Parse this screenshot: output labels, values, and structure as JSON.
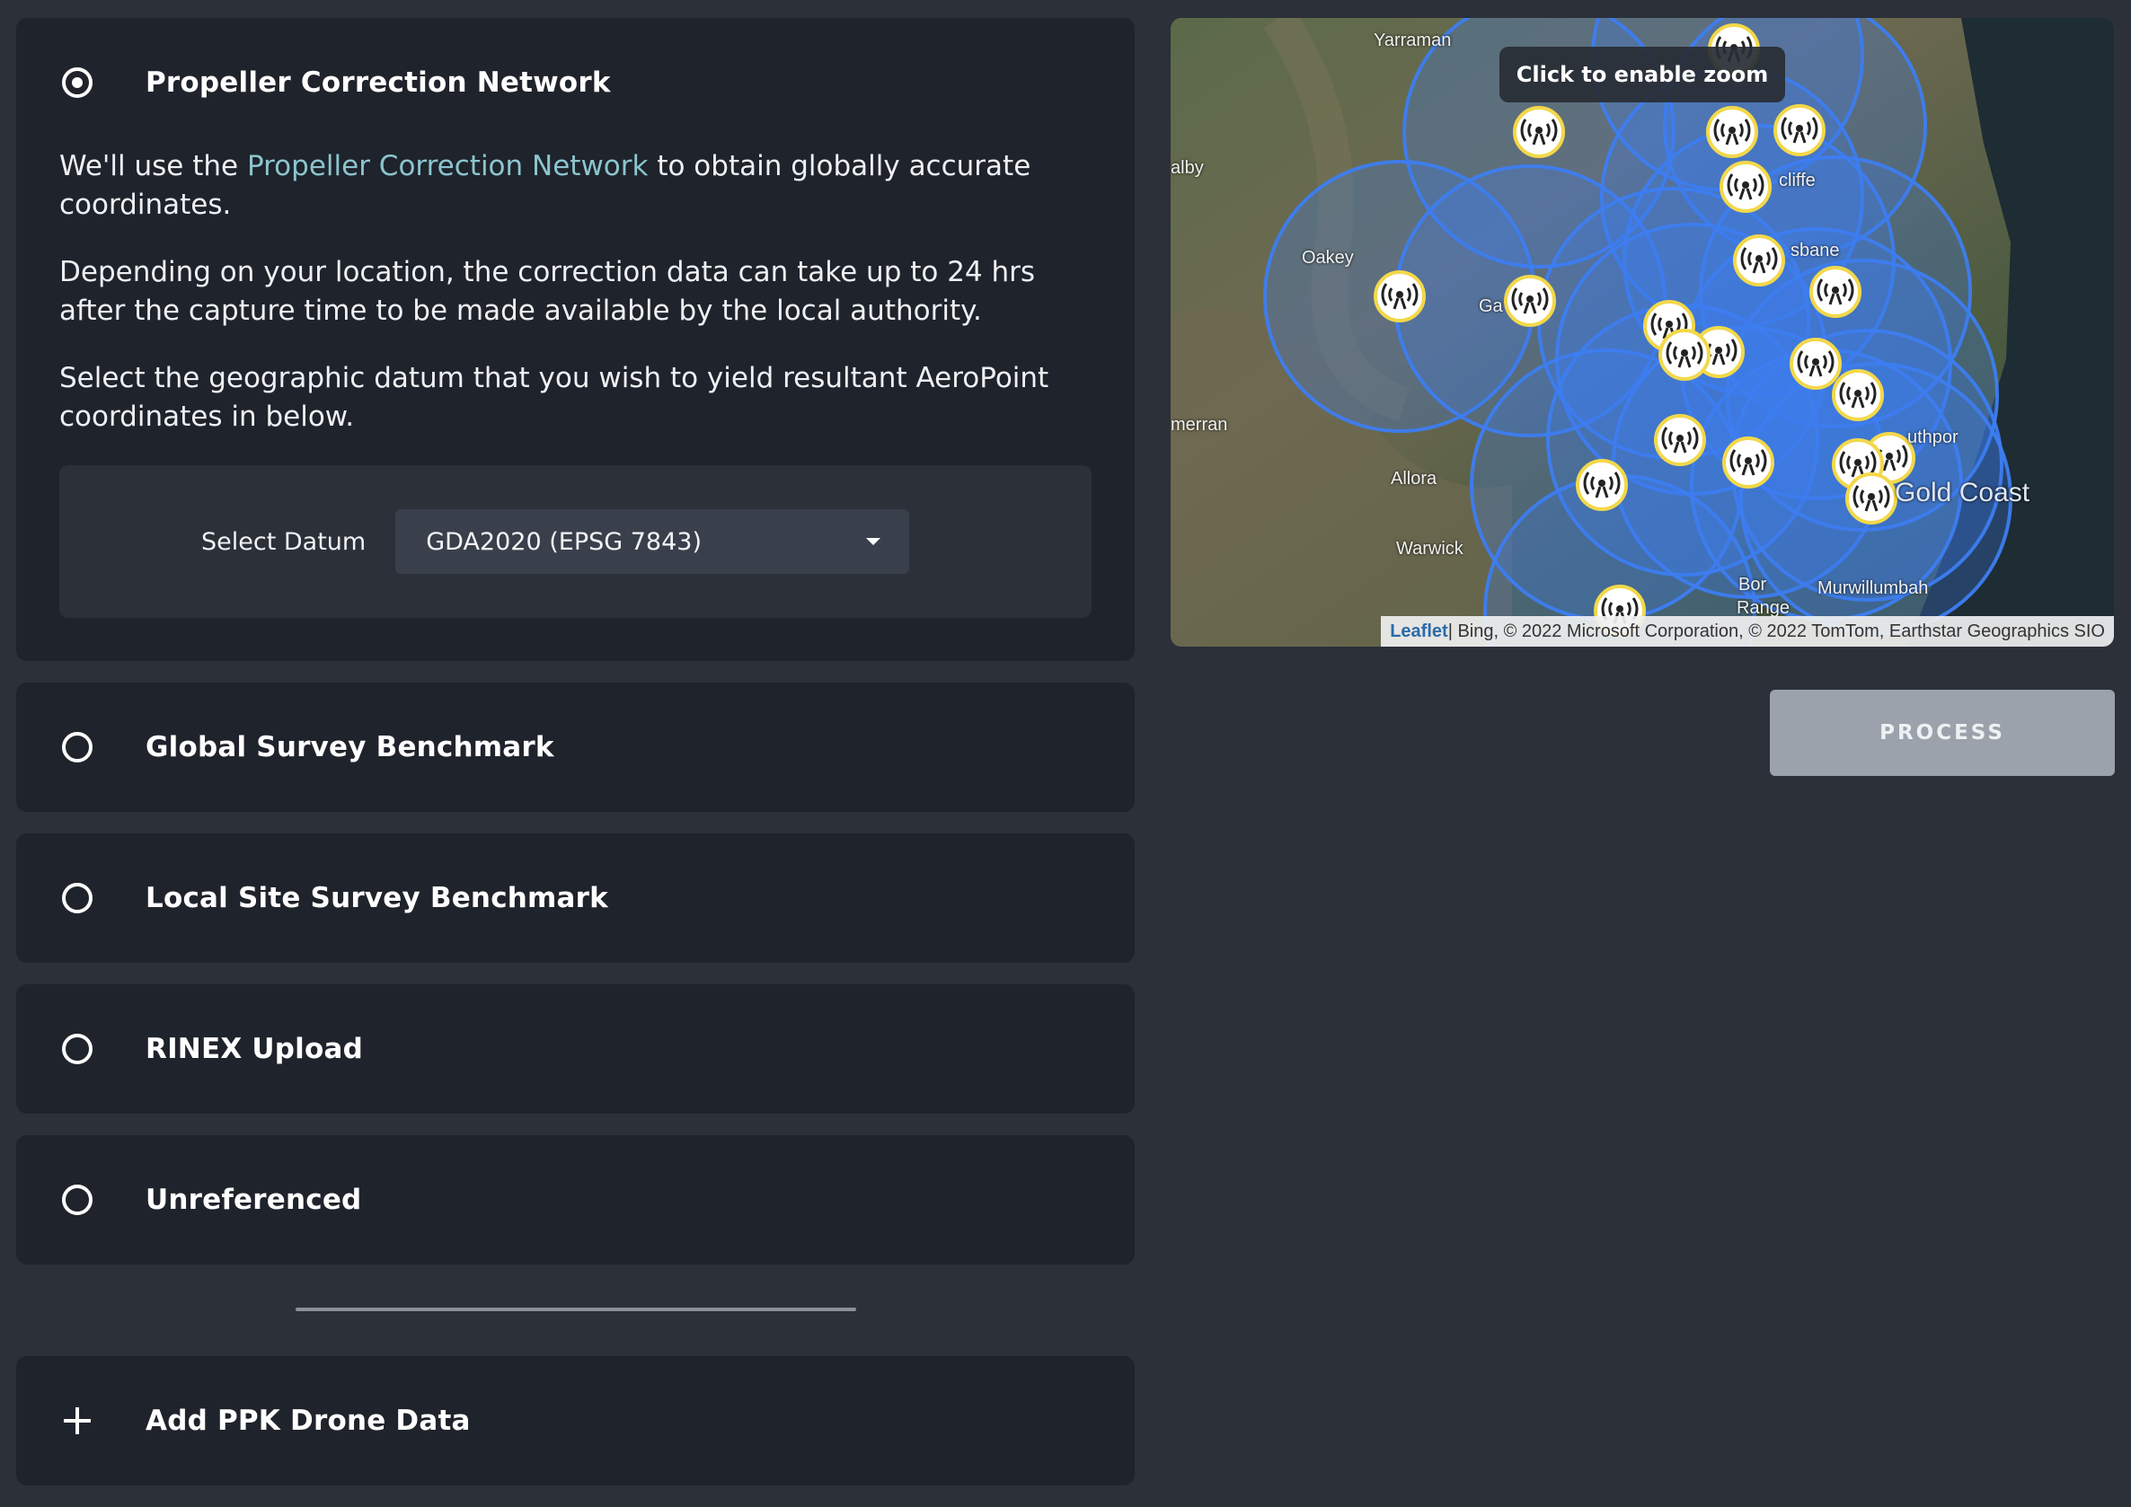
{
  "options": [
    {
      "label": "Propeller Correction Network",
      "selected": true
    },
    {
      "label": "Global Survey Benchmark",
      "selected": false
    },
    {
      "label": "Local Site Survey Benchmark",
      "selected": false
    },
    {
      "label": "RINEX Upload",
      "selected": false
    },
    {
      "label": "Unreferenced",
      "selected": false
    }
  ],
  "pcn": {
    "intro_pre": "We'll use the ",
    "intro_link": "Propeller Correction Network",
    "intro_post": " to obtain globally accurate coordinates.",
    "delay_text": "Depending on your location, the correction data can take up to 24 hrs after the capture time to be made available by the local authority.",
    "datum_text": "Select the geographic datum that you wish to yield resultant AeroPoint coordinates in below.",
    "datum_label": "Select Datum",
    "datum_value": "GDA2020 (EPSG 7843)"
  },
  "add_ppk": {
    "label": "Add PPK Drone Data"
  },
  "map": {
    "zoom_tip": "Click to enable zoom",
    "attribution_link": "Leaflet",
    "attribution_text": " | Bing, © 2022 Microsoft Corporation, © 2022 TomTom, Earthstar Geographics SIO",
    "places": [
      "Yarraman",
      "alby",
      "Oakey",
      "Ga",
      "merran",
      "Allora",
      "Warwick",
      "cliffe",
      "sbane",
      "uthpor",
      "Gold Coast",
      "Bor",
      "Range",
      "Murwillumbah"
    ],
    "circle_color": "#3d7df0",
    "marker_color": "#f2d84a"
  },
  "process_button": {
    "label": "PROCESS"
  }
}
